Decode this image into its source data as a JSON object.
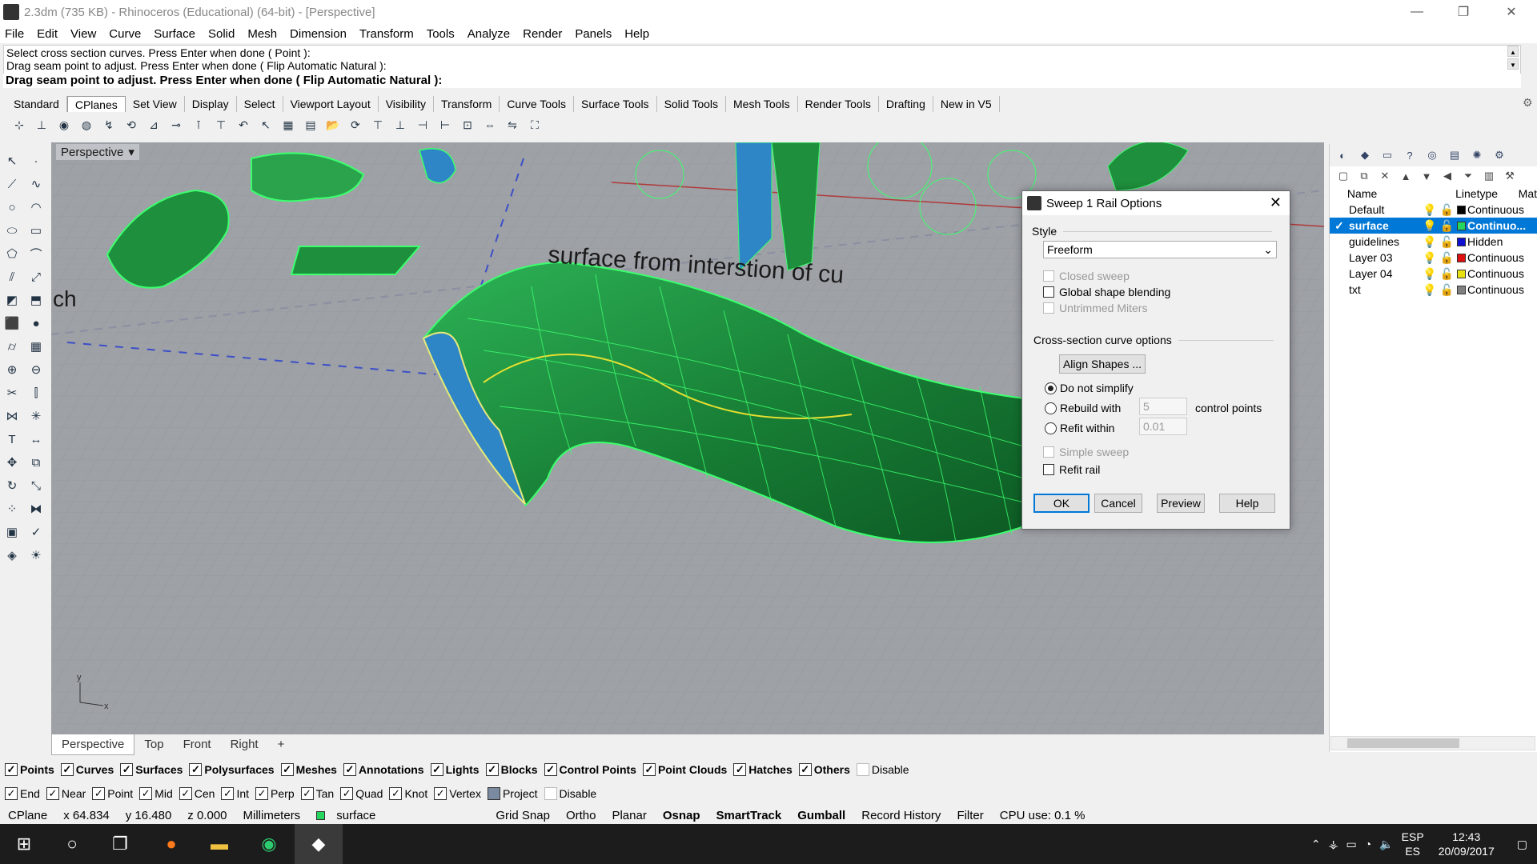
{
  "window": {
    "title": "2.3dm (735 KB) - Rhinoceros (Educational) (64-bit) - [Perspective]",
    "min": "—",
    "max": "❐",
    "close": "✕"
  },
  "menu": [
    "File",
    "Edit",
    "View",
    "Curve",
    "Surface",
    "Solid",
    "Mesh",
    "Dimension",
    "Transform",
    "Tools",
    "Analyze",
    "Render",
    "Panels",
    "Help"
  ],
  "command": {
    "history": [
      "Select cross section curves. Press Enter when done ( Point ):",
      "Drag seam point to adjust. Press Enter when done ( Flip  Automatic  Natural ):"
    ],
    "prompt": "Drag seam point to adjust. Press Enter when done ( Flip  Automatic  Natural ):"
  },
  "toolbar_tabs": [
    "Standard",
    "CPlanes",
    "Set View",
    "Display",
    "Select",
    "Viewport Layout",
    "Visibility",
    "Transform",
    "Curve Tools",
    "Surface Tools",
    "Solid Tools",
    "Mesh Tools",
    "Render Tools",
    "Drafting",
    "New in V5"
  ],
  "active_tab": "CPlanes",
  "viewport": {
    "name": "Perspective",
    "annotation": "surface from interstion of cu",
    "annotation2": "ch",
    "axis_x": "x",
    "axis_y": "y",
    "tabs": [
      "Perspective",
      "Top",
      "Front",
      "Right"
    ],
    "add_tab": "+",
    "colors": {
      "bg": "#9ea1a6",
      "surface": "#1e8f3c",
      "iso": "#3cff6e",
      "blue": "#2f86c6"
    }
  },
  "layers": {
    "header": {
      "name": "Name",
      "linetype": "Linetype",
      "mat": "Mat"
    },
    "rows": [
      {
        "name": "Default",
        "color": "#000000",
        "linetype": "Continuous",
        "selected": false,
        "check": ""
      },
      {
        "name": "surface",
        "color": "#27d65f",
        "linetype": "Continuo...",
        "selected": true,
        "check": "✓"
      },
      {
        "name": "guidelines",
        "color": "#1010d0",
        "linetype": "Hidden",
        "selected": false,
        "check": ""
      },
      {
        "name": "Layer 03",
        "color": "#e01010",
        "linetype": "Continuous",
        "selected": false,
        "check": ""
      },
      {
        "name": "Layer 04",
        "color": "#e8e010",
        "linetype": "Continuous",
        "selected": false,
        "check": ""
      },
      {
        "name": "txt",
        "color": "#808080",
        "linetype": "Continuous",
        "selected": false,
        "check": ""
      }
    ]
  },
  "dialog": {
    "title": "Sweep 1 Rail Options",
    "style_label": "Style",
    "style_value": "Freeform",
    "closed_sweep": "Closed sweep",
    "global_blending": "Global shape blending",
    "untrimmed_miters": "Untrimmed Miters",
    "cross_section_label": "Cross-section curve options",
    "align_shapes": "Align Shapes ...",
    "do_not_simplify": "Do not simplify",
    "rebuild_with": "Rebuild with",
    "rebuild_value": "5",
    "control_points": "control points",
    "refit_within": "Refit within",
    "refit_value": "0.01",
    "simple_sweep": "Simple sweep",
    "refit_rail": "Refit rail",
    "ok": "OK",
    "cancel": "Cancel",
    "preview": "Preview",
    "help": "Help"
  },
  "filters": [
    "Points",
    "Curves",
    "Surfaces",
    "Polysurfaces",
    "Meshes",
    "Annotations",
    "Lights",
    "Blocks",
    "Control Points",
    "Point Clouds",
    "Hatches",
    "Others"
  ],
  "filter_disable": "Disable",
  "osnaps": [
    "End",
    "Near",
    "Point",
    "Mid",
    "Cen",
    "Int",
    "Perp",
    "Tan",
    "Quad",
    "Knot",
    "Vertex"
  ],
  "osnap_project": "Project",
  "osnap_disable": "Disable",
  "status": {
    "cplane": "CPlane",
    "x": "x 64.834",
    "y": "y 16.480",
    "z": "z 0.000",
    "units": "Millimeters",
    "layer": "surface",
    "layer_color": "#27d65f",
    "grid_snap": "Grid Snap",
    "ortho": "Ortho",
    "planar": "Planar",
    "osnap": "Osnap",
    "smarttrack": "SmartTrack",
    "gumball": "Gumball",
    "record_history": "Record History",
    "filter": "Filter",
    "cpu": "CPU use: 0.1 %"
  },
  "taskbar": {
    "lang1": "ESP",
    "lang2": "ES",
    "time": "12:43",
    "date": "20/09/2017"
  }
}
